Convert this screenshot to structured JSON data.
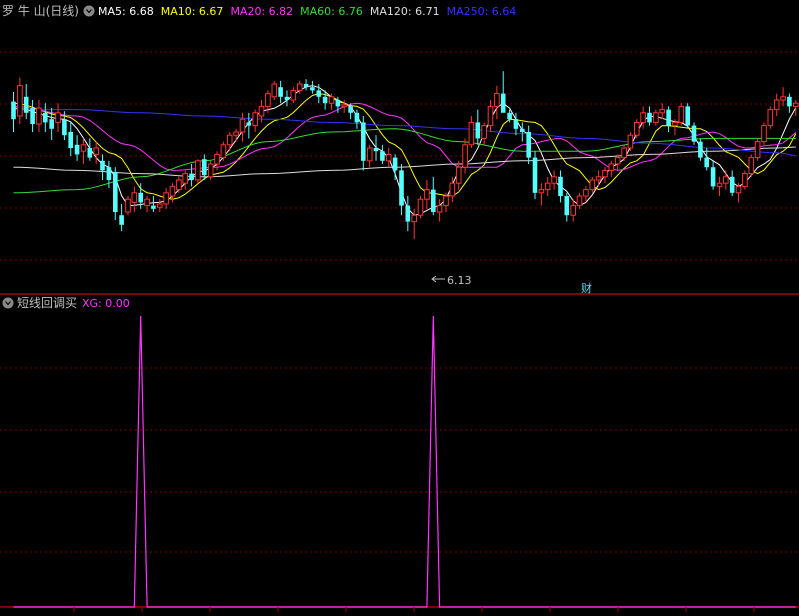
{
  "main_panel": {
    "title": "罗 牛 山(日线)",
    "legend": [
      {
        "label": "MA5: 6.68",
        "color": "#ffffff"
      },
      {
        "label": "MA10: 6.67",
        "color": "#ffff00"
      },
      {
        "label": "MA20: 6.82",
        "color": "#ff33ff"
      },
      {
        "label": "MA60: 6.76",
        "color": "#33dd33"
      },
      {
        "label": "MA120: 6.71",
        "color": "#dddddd"
      },
      {
        "label": "MA250: 6.64",
        "color": "#3333ff"
      }
    ],
    "low_marker": "6.13",
    "event_marker": "财"
  },
  "sub_panel": {
    "title": "短线回调买",
    "legend": [
      {
        "label": "XG: 0.00",
        "color": "#ff33ff"
      }
    ]
  },
  "colors": {
    "background": "#000000",
    "up": "#ff3232",
    "down": "#54ffff",
    "grid": "#800000",
    "separator": "#aa0000",
    "signal": "#ff33ff",
    "text": "#c0c0c0"
  },
  "icons": [
    "collapse-circle-icon",
    "arrow-left-icon"
  ],
  "chart_data": [
    {
      "type": "candlestick",
      "name": "price",
      "ylim": [
        6.0,
        7.3
      ],
      "candles": [
        [
          6.99,
          7.05,
          6.8,
          6.88
        ],
        [
          6.9,
          7.14,
          6.85,
          7.09
        ],
        [
          7.02,
          7.1,
          6.88,
          6.92
        ],
        [
          6.95,
          7.0,
          6.8,
          6.85
        ],
        [
          6.85,
          7.0,
          6.8,
          6.95
        ],
        [
          6.92,
          6.98,
          6.8,
          6.86
        ],
        [
          6.88,
          6.95,
          6.75,
          6.82
        ],
        [
          6.86,
          6.98,
          6.8,
          6.92
        ],
        [
          6.88,
          6.93,
          6.75,
          6.78
        ],
        [
          6.8,
          6.86,
          6.65,
          6.7
        ],
        [
          6.72,
          6.78,
          6.62,
          6.66
        ],
        [
          6.68,
          6.76,
          6.6,
          6.72
        ],
        [
          6.7,
          6.76,
          6.62,
          6.64
        ],
        [
          6.66,
          6.74,
          6.6,
          6.7
        ],
        [
          6.62,
          6.66,
          6.5,
          6.56
        ],
        [
          6.58,
          6.62,
          6.45,
          6.5
        ],
        [
          6.55,
          6.58,
          6.25,
          6.3
        ],
        [
          6.28,
          6.35,
          6.18,
          6.22
        ],
        [
          6.3,
          6.4,
          6.28,
          6.38
        ],
        [
          6.36,
          6.46,
          6.3,
          6.42
        ],
        [
          6.42,
          6.48,
          6.32,
          6.36
        ],
        [
          6.34,
          6.4,
          6.3,
          6.38
        ],
        [
          6.34,
          6.4,
          6.3,
          6.32
        ],
        [
          6.33,
          6.38,
          6.3,
          6.35
        ],
        [
          6.35,
          6.45,
          6.32,
          6.42
        ],
        [
          6.4,
          6.48,
          6.36,
          6.46
        ],
        [
          6.44,
          6.52,
          6.42,
          6.5
        ],
        [
          6.48,
          6.56,
          6.44,
          6.54
        ],
        [
          6.54,
          6.6,
          6.46,
          6.5
        ],
        [
          6.5,
          6.63,
          6.48,
          6.62
        ],
        [
          6.63,
          6.66,
          6.5,
          6.53
        ],
        [
          6.52,
          6.62,
          6.5,
          6.6
        ],
        [
          6.6,
          6.68,
          6.56,
          6.66
        ],
        [
          6.64,
          6.74,
          6.62,
          6.72
        ],
        [
          6.72,
          6.8,
          6.68,
          6.78
        ],
        [
          6.78,
          6.82,
          6.74,
          6.8
        ],
        [
          6.8,
          6.92,
          6.74,
          6.88
        ],
        [
          6.86,
          6.92,
          6.76,
          6.84
        ],
        [
          6.84,
          6.94,
          6.8,
          6.92
        ],
        [
          6.9,
          7.0,
          6.86,
          6.96
        ],
        [
          6.96,
          7.06,
          6.92,
          7.04
        ],
        [
          7.02,
          7.12,
          7.0,
          7.1
        ],
        [
          7.08,
          7.12,
          6.98,
          7.02
        ],
        [
          7.02,
          7.06,
          6.96,
          7.0
        ],
        [
          7.0,
          7.08,
          6.98,
          7.06
        ],
        [
          7.06,
          7.12,
          7.04,
          7.1
        ],
        [
          7.1,
          7.13,
          7.06,
          7.08
        ],
        [
          7.08,
          7.12,
          7.04,
          7.06
        ],
        [
          7.06,
          7.1,
          6.98,
          7.02
        ],
        [
          7.02,
          7.06,
          6.94,
          6.98
        ],
        [
          6.98,
          7.04,
          6.94,
          7.02
        ],
        [
          7.0,
          7.02,
          6.92,
          6.96
        ],
        [
          6.96,
          7.0,
          6.92,
          6.97
        ],
        [
          6.96,
          6.98,
          6.88,
          6.92
        ],
        [
          6.92,
          6.94,
          6.82,
          6.86
        ],
        [
          6.86,
          6.9,
          6.56,
          6.62
        ],
        [
          6.62,
          6.72,
          6.58,
          6.7
        ],
        [
          6.7,
          6.78,
          6.62,
          6.68
        ],
        [
          6.68,
          6.72,
          6.6,
          6.62
        ],
        [
          6.62,
          6.7,
          6.58,
          6.66
        ],
        [
          6.64,
          6.66,
          6.5,
          6.56
        ],
        [
          6.56,
          6.6,
          6.28,
          6.34
        ],
        [
          6.34,
          6.4,
          6.18,
          6.24
        ],
        [
          6.24,
          6.32,
          6.13,
          6.28
        ],
        [
          6.28,
          6.4,
          6.26,
          6.38
        ],
        [
          6.38,
          6.5,
          6.32,
          6.44
        ],
        [
          6.44,
          6.52,
          6.28,
          6.3
        ],
        [
          6.3,
          6.38,
          6.24,
          6.34
        ],
        [
          6.34,
          6.42,
          6.3,
          6.4
        ],
        [
          6.4,
          6.52,
          6.36,
          6.48
        ],
        [
          6.48,
          6.62,
          6.44,
          6.58
        ],
        [
          6.58,
          6.76,
          6.54,
          6.72
        ],
        [
          6.72,
          6.9,
          6.7,
          6.86
        ],
        [
          6.86,
          6.94,
          6.72,
          6.76
        ],
        [
          6.76,
          6.86,
          6.72,
          6.84
        ],
        [
          6.84,
          7.0,
          6.8,
          6.96
        ],
        [
          6.96,
          7.09,
          6.88,
          7.04
        ],
        [
          7.04,
          7.18,
          6.96,
          6.92
        ],
        [
          6.92,
          6.94,
          6.86,
          6.88
        ],
        [
          6.88,
          6.92,
          6.78,
          6.82
        ],
        [
          6.82,
          6.86,
          6.74,
          6.8
        ],
        [
          6.8,
          6.84,
          6.6,
          6.64
        ],
        [
          6.64,
          6.68,
          6.38,
          6.42
        ],
        [
          6.42,
          6.48,
          6.34,
          6.44
        ],
        [
          6.44,
          6.52,
          6.4,
          6.48
        ],
        [
          6.48,
          6.56,
          6.44,
          6.52
        ],
        [
          6.52,
          6.56,
          6.36,
          6.4
        ],
        [
          6.4,
          6.42,
          6.24,
          6.28
        ],
        [
          6.28,
          6.38,
          6.24,
          6.34
        ],
        [
          6.34,
          6.42,
          6.32,
          6.4
        ],
        [
          6.4,
          6.46,
          6.36,
          6.44
        ],
        [
          6.44,
          6.52,
          6.42,
          6.5
        ],
        [
          6.5,
          6.56,
          6.46,
          6.52
        ],
        [
          6.52,
          6.58,
          6.48,
          6.56
        ],
        [
          6.56,
          6.62,
          6.52,
          6.6
        ],
        [
          6.6,
          6.66,
          6.56,
          6.64
        ],
        [
          6.64,
          6.72,
          6.62,
          6.7
        ],
        [
          6.7,
          6.8,
          6.68,
          6.78
        ],
        [
          6.78,
          6.88,
          6.76,
          6.86
        ],
        [
          6.86,
          6.96,
          6.82,
          6.92
        ],
        [
          6.92,
          6.96,
          6.84,
          6.86
        ],
        [
          6.86,
          6.94,
          6.84,
          6.92
        ],
        [
          6.92,
          6.98,
          6.88,
          6.94
        ],
        [
          6.94,
          6.96,
          6.8,
          6.84
        ],
        [
          6.84,
          6.88,
          6.78,
          6.86
        ],
        [
          6.86,
          6.98,
          6.84,
          6.96
        ],
        [
          6.96,
          6.98,
          6.82,
          6.84
        ],
        [
          6.84,
          6.86,
          6.72,
          6.74
        ],
        [
          6.74,
          6.76,
          6.62,
          6.64
        ],
        [
          6.64,
          6.7,
          6.56,
          6.58
        ],
        [
          6.58,
          6.62,
          6.44,
          6.46
        ],
        [
          6.46,
          6.52,
          6.4,
          6.48
        ],
        [
          6.48,
          6.56,
          6.44,
          6.52
        ],
        [
          6.52,
          6.56,
          6.4,
          6.42
        ],
        [
          6.42,
          6.48,
          6.36,
          6.46
        ],
        [
          6.46,
          6.56,
          6.44,
          6.54
        ],
        [
          6.54,
          6.66,
          6.52,
          6.64
        ],
        [
          6.64,
          6.76,
          6.62,
          6.74
        ],
        [
          6.74,
          6.86,
          6.72,
          6.84
        ],
        [
          6.84,
          6.96,
          6.82,
          6.94
        ],
        [
          6.94,
          7.04,
          6.9,
          7.0
        ],
        [
          7.0,
          7.08,
          6.96,
          7.02
        ],
        [
          7.02,
          7.04,
          6.92,
          6.96
        ],
        [
          6.96,
          7.0,
          6.9,
          6.98
        ]
      ]
    },
    {
      "type": "line",
      "name": "moving-averages",
      "series_names": [
        "MA5",
        "MA10",
        "MA20",
        "MA60",
        "MA120",
        "MA250"
      ],
      "ma5_anchors": [
        [
          0,
          6.95
        ],
        [
          8,
          6.88
        ],
        [
          15,
          6.58
        ],
        [
          18,
          6.34
        ],
        [
          23,
          6.36
        ],
        [
          30,
          6.56
        ],
        [
          40,
          6.94
        ],
        [
          47,
          7.09
        ],
        [
          52,
          6.98
        ],
        [
          58,
          6.68
        ],
        [
          63,
          6.28
        ],
        [
          67,
          6.34
        ],
        [
          71,
          6.6
        ],
        [
          77,
          6.98
        ],
        [
          81,
          6.78
        ],
        [
          86,
          6.46
        ],
        [
          89,
          6.34
        ],
        [
          95,
          6.6
        ],
        [
          100,
          6.9
        ],
        [
          105,
          6.86
        ],
        [
          110,
          6.62
        ],
        [
          114,
          6.46
        ],
        [
          118,
          6.6
        ],
        [
          124,
          6.98
        ],
        [
          125,
          6.98
        ]
      ],
      "ma10_anchors": [
        [
          0,
          6.98
        ],
        [
          8,
          6.9
        ],
        [
          16,
          6.66
        ],
        [
          21,
          6.42
        ],
        [
          25,
          6.38
        ],
        [
          32,
          6.54
        ],
        [
          42,
          6.88
        ],
        [
          48,
          7.04
        ],
        [
          54,
          6.96
        ],
        [
          60,
          6.72
        ],
        [
          65,
          6.42
        ],
        [
          69,
          6.4
        ],
        [
          73,
          6.56
        ],
        [
          78,
          6.88
        ],
        [
          82,
          6.86
        ],
        [
          88,
          6.58
        ],
        [
          92,
          6.44
        ],
        [
          98,
          6.62
        ],
        [
          102,
          6.84
        ],
        [
          108,
          6.82
        ],
        [
          113,
          6.66
        ],
        [
          117,
          6.54
        ],
        [
          121,
          6.68
        ],
        [
          125,
          6.9
        ]
      ],
      "ma20_anchors": [
        [
          0,
          6.96
        ],
        [
          10,
          6.9
        ],
        [
          18,
          6.72
        ],
        [
          25,
          6.56
        ],
        [
          32,
          6.58
        ],
        [
          40,
          6.7
        ],
        [
          48,
          6.9
        ],
        [
          54,
          6.98
        ],
        [
          60,
          6.9
        ],
        [
          66,
          6.72
        ],
        [
          70,
          6.58
        ],
        [
          76,
          6.58
        ],
        [
          80,
          6.72
        ],
        [
          86,
          6.76
        ],
        [
          90,
          6.66
        ],
        [
          95,
          6.56
        ],
        [
          100,
          6.62
        ],
        [
          105,
          6.76
        ],
        [
          110,
          6.8
        ],
        [
          115,
          6.7
        ],
        [
          120,
          6.72
        ],
        [
          125,
          6.84
        ]
      ],
      "ma60_anchors": [
        [
          0,
          6.42
        ],
        [
          10,
          6.44
        ],
        [
          20,
          6.52
        ],
        [
          30,
          6.62
        ],
        [
          40,
          6.74
        ],
        [
          50,
          6.8
        ],
        [
          60,
          6.82
        ],
        [
          70,
          6.74
        ],
        [
          80,
          6.68
        ],
        [
          90,
          6.68
        ],
        [
          100,
          6.74
        ],
        [
          110,
          6.76
        ],
        [
          120,
          6.76
        ],
        [
          125,
          6.76
        ]
      ],
      "ma120_anchors": [
        [
          0,
          6.58
        ],
        [
          10,
          6.56
        ],
        [
          20,
          6.54
        ],
        [
          30,
          6.52
        ],
        [
          40,
          6.54
        ],
        [
          50,
          6.56
        ],
        [
          60,
          6.58
        ],
        [
          70,
          6.6
        ],
        [
          80,
          6.62
        ],
        [
          90,
          6.64
        ],
        [
          100,
          6.66
        ],
        [
          110,
          6.68
        ],
        [
          120,
          6.7
        ],
        [
          125,
          6.71
        ]
      ],
      "ma250_anchors": [
        [
          0,
          6.94
        ],
        [
          10,
          6.94
        ],
        [
          20,
          6.92
        ],
        [
          30,
          6.9
        ],
        [
          40,
          6.88
        ],
        [
          50,
          6.86
        ],
        [
          60,
          6.84
        ],
        [
          70,
          6.82
        ],
        [
          80,
          6.79
        ],
        [
          90,
          6.76
        ],
        [
          100,
          6.73
        ],
        [
          110,
          6.7
        ],
        [
          120,
          6.67
        ],
        [
          125,
          6.64
        ]
      ]
    },
    {
      "type": "line",
      "name": "XG",
      "ylim": [
        0,
        1
      ],
      "spikes_at_index": [
        20,
        66
      ],
      "values_note_removed": true
    }
  ]
}
